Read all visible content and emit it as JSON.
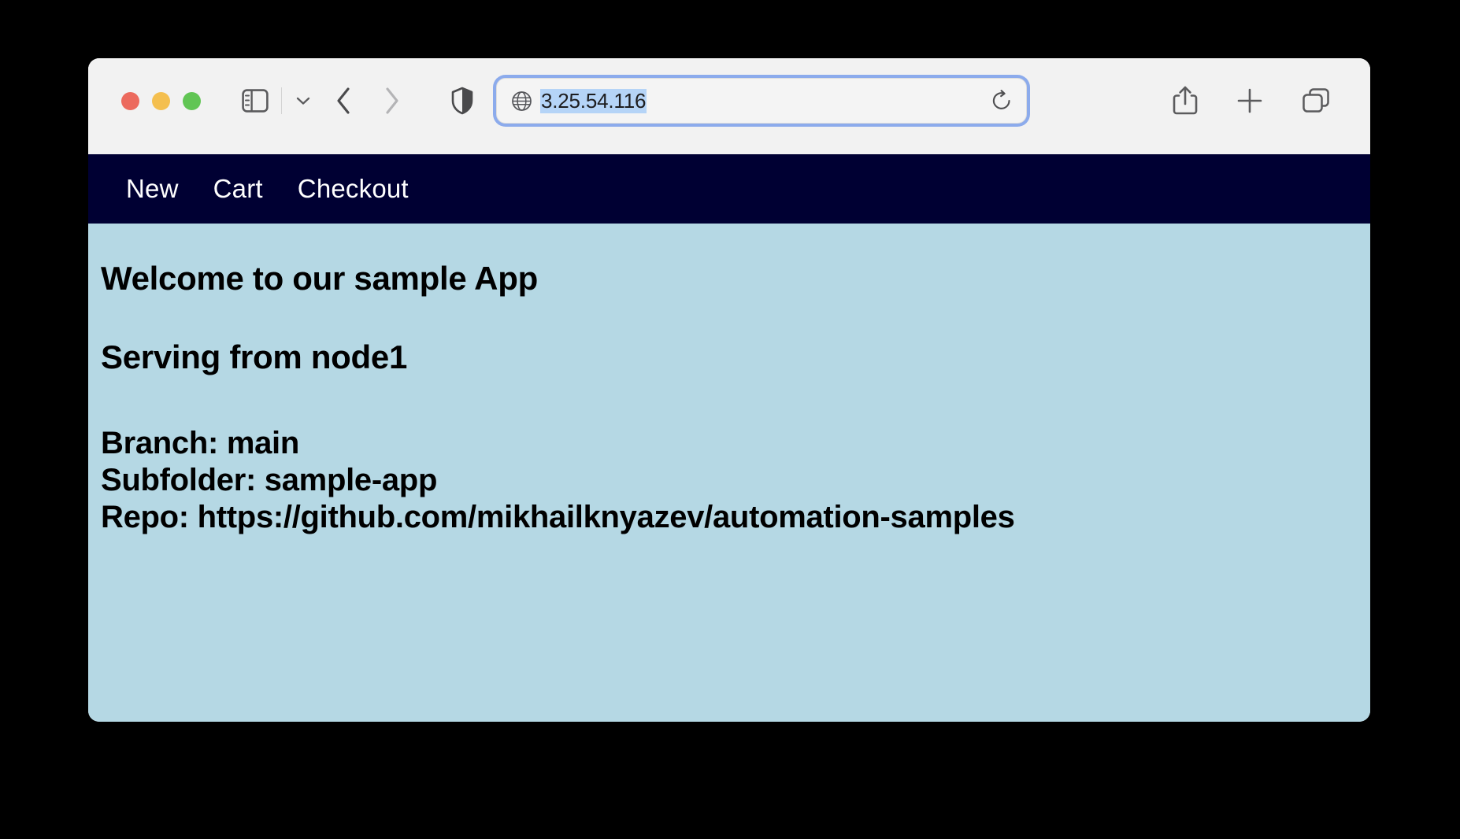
{
  "browser": {
    "app": "Safari",
    "window_controls": [
      {
        "name": "close",
        "color": "#ec6a5e"
      },
      {
        "name": "minimize",
        "color": "#f4bf4f"
      },
      {
        "name": "maximize",
        "color": "#61c554"
      }
    ],
    "toolbar": {
      "sidebar_icon": "sidebar-icon",
      "sidebar_dropdown_icon": "chevron-down-icon",
      "back_icon": "chevron-left-icon",
      "forward_icon": "chevron-right-icon",
      "privacy_icon": "shield-icon",
      "share_icon": "share-icon",
      "new_tab_icon": "plus-icon",
      "tab_overview_icon": "tab-overview-icon"
    },
    "address_bar": {
      "site_icon": "globe-icon",
      "url": "3.25.54.116",
      "selected": true,
      "selection_color": "#b5d4f7",
      "focus_ring_color": "#8cabec",
      "reload_icon": "reload-icon"
    }
  },
  "page": {
    "background_color": "#b5d8e4",
    "nav": {
      "background_color": "#000033",
      "text_color": "#ffffff",
      "items": [
        {
          "label": "New"
        },
        {
          "label": "Cart"
        },
        {
          "label": "Checkout"
        }
      ]
    },
    "headings": {
      "welcome": "Welcome to our sample App",
      "serving": "Serving from node1"
    },
    "info": {
      "branch": "Branch: main",
      "subfolder": "Subfolder: sample-app",
      "repo": "Repo: https://github.com/mikhailknyazev/automation-samples"
    }
  }
}
